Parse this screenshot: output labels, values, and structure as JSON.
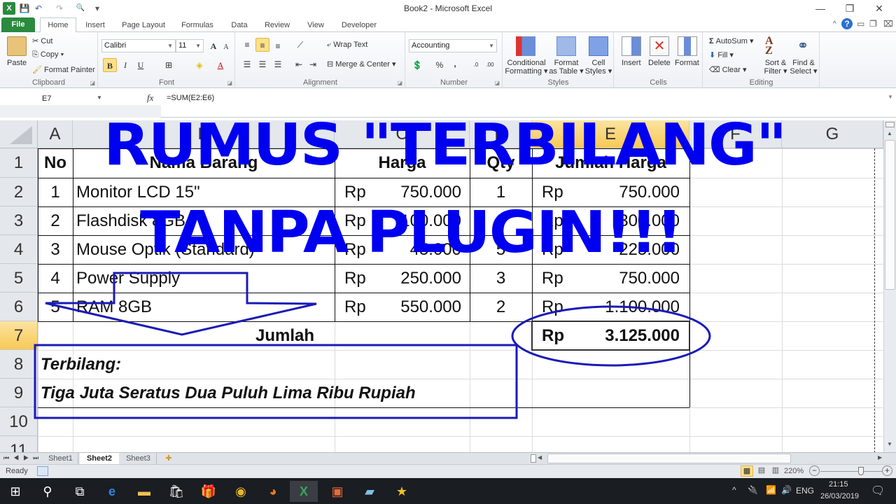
{
  "window": {
    "title": "Book2  -  Microsoft Excel",
    "minimize": "—",
    "restore": "❐",
    "close": "✕"
  },
  "quick_access": {
    "save": "💾",
    "undo": "↶",
    "redo": "↷",
    "print_preview": "🔍",
    "customize": "▾"
  },
  "tabs": [
    {
      "label": "File"
    },
    {
      "label": "Home"
    },
    {
      "label": "Insert"
    },
    {
      "label": "Page Layout"
    },
    {
      "label": "Formulas"
    },
    {
      "label": "Data"
    },
    {
      "label": "Review"
    },
    {
      "label": "View"
    },
    {
      "label": "Developer"
    }
  ],
  "ribbon": {
    "clipboard": {
      "label": "Clipboard",
      "paste": "Paste",
      "cut": "Cut",
      "copy": "Copy ▾",
      "format_painter": "Format Painter"
    },
    "font": {
      "label": "Font",
      "font_name": "Calibri",
      "font_size": "11",
      "bold": "B",
      "italic": "I",
      "underline": "U",
      "grow": "A",
      "shrink": "A"
    },
    "alignment": {
      "label": "Alignment",
      "wrap_text": "Wrap Text",
      "merge_center": "Merge & Center"
    },
    "number": {
      "label": "Number",
      "format": "Accounting",
      "percent": "%",
      "comma": ",",
      "inc_decimal": "←.0 .00",
      "dec_decimal": ".00 →.0"
    },
    "styles": {
      "label": "Styles",
      "conditional": "Conditional",
      "conditional2": "Formatting ▾",
      "format_table": "Format",
      "format_table2": "as Table ▾",
      "cell_styles": "Cell",
      "cell_styles2": "Styles ▾"
    },
    "cells": {
      "label": "Cells",
      "insert": "Insert",
      "delete": "Delete",
      "format": "Format"
    },
    "editing": {
      "label": "Editing",
      "autosum": "AutoSum ▾",
      "fill": "Fill ▾",
      "clear": "Clear ▾",
      "sort": "Sort &",
      "sort2": "Filter ▾",
      "find": "Find &",
      "find2": "Select ▾"
    }
  },
  "formula_bar": {
    "name_box": "E7",
    "fx": "fx",
    "formula": "=SUM(E2:E6)"
  },
  "columns": [
    "A",
    "B",
    "C",
    "D",
    "E",
    "F",
    "G"
  ],
  "rows": [
    "1",
    "2",
    "3",
    "4",
    "5",
    "6",
    "7",
    "8",
    "9",
    "10",
    "11"
  ],
  "table": {
    "headers": [
      "No",
      "Nama Barang",
      "Harga",
      "Qty",
      "Jumlah Harga"
    ],
    "currency": "Rp",
    "data": [
      {
        "no": "1",
        "nama": "Monitor LCD 15\"",
        "harga": "750.000",
        "qty": "1",
        "jumlah": "750.000"
      },
      {
        "no": "2",
        "nama": "Flashdisk 8GB",
        "harga": "100.000",
        "qty": "3",
        "jumlah": "300.000"
      },
      {
        "no": "3",
        "nama": "Mouse Optik (Standard)",
        "harga": "45.000",
        "qty": "5",
        "jumlah": "225.000"
      },
      {
        "no": "4",
        "nama": "Power Supply",
        "harga": "250.000",
        "qty": "3",
        "jumlah": "750.000"
      },
      {
        "no": "5",
        "nama": "RAM 8GB",
        "harga": "550.000",
        "qty": "2",
        "jumlah": "1.100.000"
      }
    ],
    "total_label": "Jumlah",
    "total_value": "3.125.000",
    "terbilang_label": "Terbilang:",
    "terbilang_text": "Tiga Juta Seratus Dua Puluh Lima Ribu Rupiah"
  },
  "overlay": {
    "line1": "RUMUS \"TERBILANG\"",
    "line2": "TANPA PLUGIN!!!",
    "color": "#0000f0",
    "annotation_color": "#1a1ab8"
  },
  "sheets": [
    {
      "label": "Sheet1",
      "active": false
    },
    {
      "label": "Sheet2",
      "active": true
    },
    {
      "label": "Sheet3",
      "active": false
    }
  ],
  "status": {
    "ready": "Ready",
    "zoom": "220%",
    "zoom_minus": "−",
    "zoom_plus": "+"
  },
  "taskbar": {
    "apps": [
      "start",
      "search",
      "task-view",
      "edge",
      "file-explorer",
      "store",
      "gift",
      "chrome",
      "firefox",
      "excel",
      "office",
      "notepad",
      "movie-maker"
    ],
    "language": "ENG",
    "time": "21:15",
    "date": "26/03/2019"
  }
}
